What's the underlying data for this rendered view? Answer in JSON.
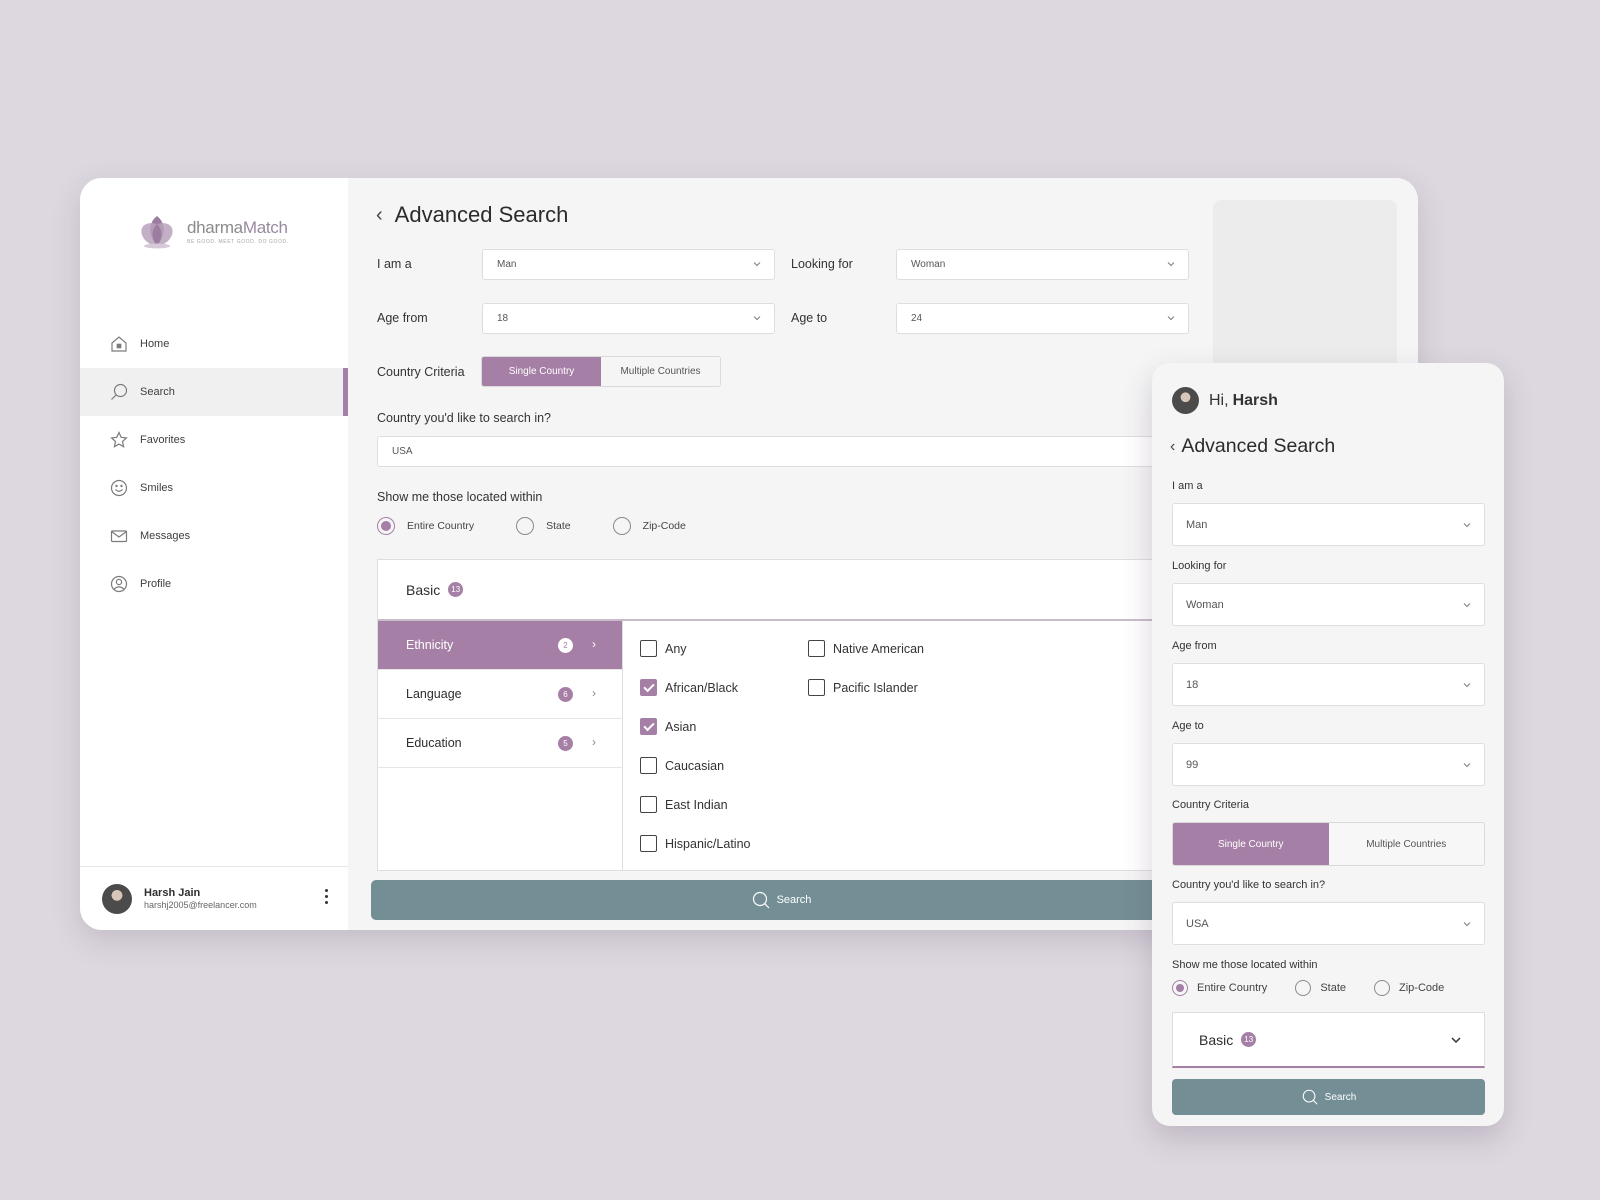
{
  "brand": {
    "name_light": "dharma",
    "name_accent": "Match",
    "tagline": "BE GOOD. MEET GOOD. DO GOOD."
  },
  "colors": {
    "accent": "#a57fa5",
    "button": "#748e95",
    "background": "#ddd8df"
  },
  "nav": [
    {
      "label": "Home",
      "icon": "home-icon"
    },
    {
      "label": "Search",
      "icon": "search-icon",
      "active": true
    },
    {
      "label": "Favorites",
      "icon": "star-icon"
    },
    {
      "label": "Smiles",
      "icon": "smile-icon"
    },
    {
      "label": "Messages",
      "icon": "mail-icon"
    },
    {
      "label": "Profile",
      "icon": "user-icon"
    }
  ],
  "user": {
    "name": "Harsh Jain",
    "email": "harshj2005@freelancer.com"
  },
  "desktop": {
    "title": "Advanced Search",
    "i_am_label": "I am a",
    "i_am_value": "Man",
    "looking_for_label": "Looking for",
    "looking_for_value": "Woman",
    "age_from_label": "Age from",
    "age_from_value": "18",
    "age_to_label": "Age to",
    "age_to_value": "24",
    "country_criteria_label": "Country Criteria",
    "single_country": "Single Country",
    "multiple_countries": "Multiple Countries",
    "country_question": "Country you'd like to search in?",
    "country_value": "USA",
    "located_label": "Show me those located within",
    "radio_entire": "Entire Country",
    "radio_state": "State",
    "radio_zip": "Zip-Code",
    "basic_label": "Basic",
    "basic_count": "13",
    "categories": [
      {
        "label": "Ethnicity",
        "count": "2"
      },
      {
        "label": "Language",
        "count": "6"
      },
      {
        "label": "Education",
        "count": "5"
      }
    ],
    "options": [
      {
        "label": "Any",
        "checked": false
      },
      {
        "label": "African/Black",
        "checked": true
      },
      {
        "label": "Asian",
        "checked": true
      },
      {
        "label": "Caucasian",
        "checked": false
      },
      {
        "label": "East Indian",
        "checked": false
      },
      {
        "label": "Hispanic/Latino",
        "checked": false
      },
      {
        "label": "Native American",
        "checked": false
      },
      {
        "label": "Pacific Islander",
        "checked": false
      }
    ],
    "search_button": "Search"
  },
  "mobile": {
    "greeting": "Hi,",
    "greeting_name": "Harsh",
    "title": "Advanced Search",
    "i_am_label": "I am a",
    "i_am_value": "Man",
    "looking_for_label": "Looking for",
    "looking_for_value": "Woman",
    "age_from_label": "Age from",
    "age_from_value": "18",
    "age_to_label": "Age to",
    "age_to_value": "99",
    "country_criteria_label": "Country Criteria",
    "single_country": "Single Country",
    "multiple_countries": "Multiple Countries",
    "country_question": "Country you'd like to search in?",
    "country_value": "USA",
    "located_label": "Show me those located within",
    "radio_entire": "Entire Country",
    "radio_state": "State",
    "radio_zip": "Zip-Code",
    "basic_label": "Basic",
    "basic_count": "13",
    "search_button": "Search"
  }
}
